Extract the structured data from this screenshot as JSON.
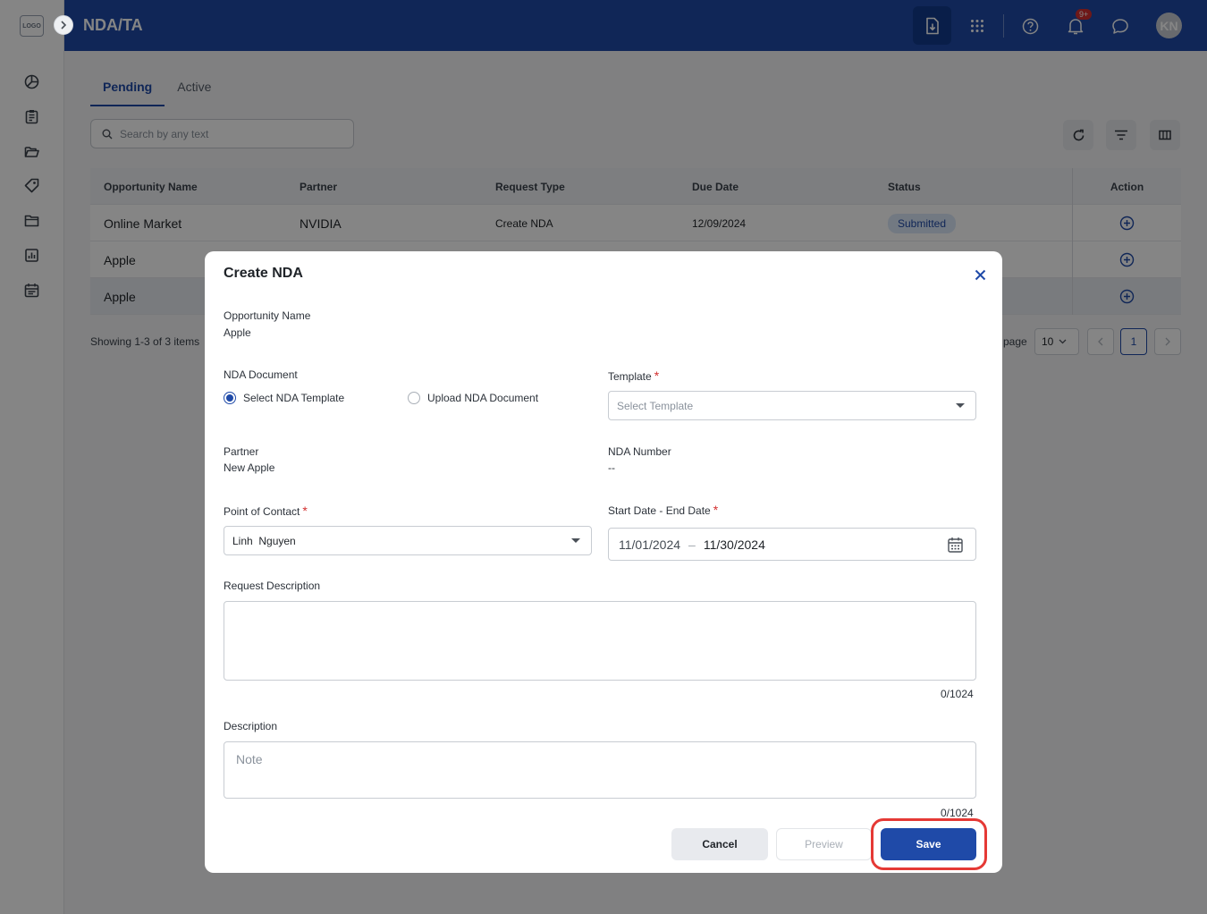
{
  "sidebar": {
    "logo_text": "LOGO",
    "icons": [
      "dashboard-icon",
      "clipboard-icon",
      "folder-open-icon",
      "tag-icon",
      "folder-icon",
      "report-icon",
      "calendar-icon"
    ]
  },
  "header": {
    "title": "NDA/TA",
    "notification_badge": "9+",
    "avatar_initials": "KN",
    "accent": "#1f4aa8"
  },
  "tabs": [
    {
      "label": "Pending",
      "active": true
    },
    {
      "label": "Active",
      "active": false
    }
  ],
  "search": {
    "placeholder": "Search by any text"
  },
  "table": {
    "columns": [
      "Opportunity Name",
      "Partner",
      "Request Type",
      "Due Date",
      "Status",
      "Action"
    ],
    "rows": [
      {
        "opportunity": "Online Market",
        "partner": "NVIDIA",
        "request_type": "Create NDA",
        "due_date": "12/09/2024",
        "status": "Submitted"
      },
      {
        "opportunity": "Apple",
        "partner": "",
        "request_type": "",
        "due_date": "",
        "status": ""
      },
      {
        "opportunity": "Apple",
        "partner": "",
        "request_type": "",
        "due_date": "",
        "status": ""
      }
    ]
  },
  "pagination": {
    "summary": "Showing 1-3 of 3 items",
    "page_label": "page",
    "page_size": "10",
    "current_page": "1"
  },
  "modal": {
    "title": "Create NDA",
    "opportunity_label": "Opportunity Name",
    "opportunity_value": "Apple",
    "nda_document_label": "NDA Document",
    "radio_template": "Select NDA Template",
    "radio_upload": "Upload NDA Document",
    "template_label": "Template",
    "template_placeholder": "Select Template",
    "partner_label": "Partner",
    "partner_value": "New Apple",
    "nda_number_label": "NDA Number",
    "nda_number_value": "--",
    "contact_label": "Point of Contact",
    "contact_value": "Linh  Nguyen",
    "dates_label": "Start Date - End Date",
    "start_date": "11/01/2024",
    "date_separator": "–",
    "end_date": "11/30/2024",
    "request_desc_label": "Request Description",
    "request_desc_counter": "0/1024",
    "description_label": "Description",
    "description_placeholder": "Note",
    "description_counter": "0/1024",
    "required_mark": "*",
    "buttons": {
      "cancel": "Cancel",
      "preview": "Preview",
      "save": "Save"
    }
  }
}
